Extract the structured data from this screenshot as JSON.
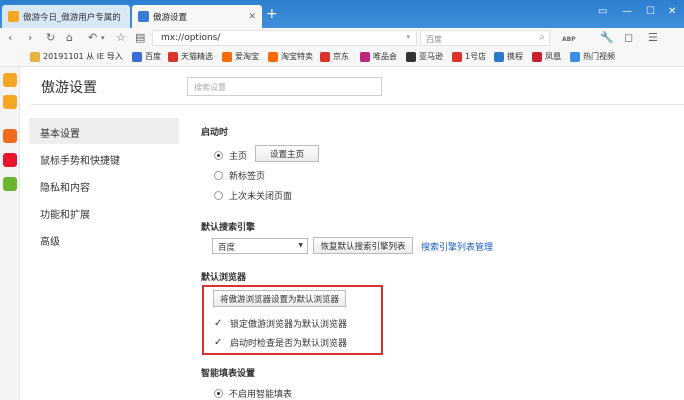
{
  "window": {
    "tabs": [
      {
        "label": "傲游今日_傲游用户专属的",
        "icon": "maxthon-today-icon"
      },
      {
        "label": "傲游设置",
        "icon": "settings-tab-icon"
      }
    ],
    "new_tab_label": "+",
    "controls": {
      "pin": "▭",
      "minimize": "—",
      "maximize": "☐",
      "close": "✕"
    }
  },
  "toolbar": {
    "back": "‹",
    "forward": "›",
    "reload": "↻",
    "home": "⌂",
    "undo": "↶",
    "undo_dropdown": "▾",
    "favorite": "☆",
    "reader": "▤",
    "address": "mx://options/",
    "address_dropdown": "▾",
    "search_placeholder": "百度",
    "search_glyph": "⌕",
    "right_icons": [
      "ABP",
      "🔧",
      "◻",
      "☰"
    ],
    "right_colors": [
      "#444444",
      "#666666",
      "#666666",
      "#666666"
    ]
  },
  "bookmarks": [
    {
      "label": "20191101 从 IE 导入",
      "color": "#e8b440"
    },
    {
      "label": "百度",
      "color": "#3b6fd4"
    },
    {
      "label": "天猫精选",
      "color": "#d9332b"
    },
    {
      "label": "爱淘宝",
      "color": "#ff6a00"
    },
    {
      "label": "淘宝特卖",
      "color": "#ff6a00"
    },
    {
      "label": "京东",
      "color": "#d9332b"
    },
    {
      "label": "唯品会",
      "color": "#c0267a"
    },
    {
      "label": "亚马逊",
      "color": "#333333"
    },
    {
      "label": "1号店",
      "color": "#d9332b"
    },
    {
      "label": "携程",
      "color": "#2a7ad2"
    },
    {
      "label": "凤凰",
      "color": "#c8232c"
    },
    {
      "label": "热门视频",
      "color": "#3a8ee6"
    }
  ],
  "side_strip": [
    {
      "name": "favorites",
      "color": "#f5a623"
    },
    {
      "name": "notes",
      "color": "#f5a623"
    },
    {
      "name": "rss",
      "color": "#f26a1b"
    },
    {
      "name": "weibo",
      "color": "#e6162d"
    },
    {
      "name": "extension",
      "color": "#6bb52f"
    }
  ],
  "settings": {
    "title": "傲游设置",
    "search_placeholder": "搜索设置",
    "menu": [
      "基本设置",
      "鼠标手势和快捷键",
      "隐私和内容",
      "功能和扩展",
      "高级"
    ],
    "startup": {
      "title": "启动时",
      "options": [
        {
          "label": "主页",
          "checked": true
        },
        {
          "label": "新标签页",
          "checked": false
        },
        {
          "label": "上次未关闭页面",
          "checked": false
        }
      ],
      "set_home_button": "设置主页"
    },
    "search_engine": {
      "title": "默认搜索引擎",
      "selected": "百度",
      "reset_button": "恢复默认搜索引擎列表",
      "manage_link": "搜索引擎列表管理"
    },
    "default_browser": {
      "title": "默认浏览器",
      "set_button": "将傲游浏览器设置为默认浏览器",
      "lock_label": "锁定傲游浏览器为默认浏览器",
      "lock_checked": true,
      "check_label": "启动时检查是否为默认浏览器",
      "check_checked": true
    },
    "autofill": {
      "title": "智能填表设置",
      "option": "不启用智能填表",
      "option_checked": true
    }
  }
}
